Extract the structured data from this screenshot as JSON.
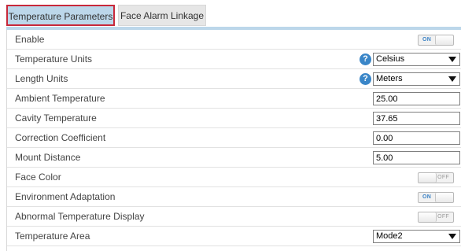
{
  "tabs": {
    "active": "Temperature Parameters",
    "inactive": "Face Alarm Linkage"
  },
  "toggle_text": {
    "on": "ON",
    "off": "OFF"
  },
  "help_glyph": "?",
  "rows": {
    "enable": {
      "label": "Enable",
      "state": "on"
    },
    "temperature_units": {
      "label": "Temperature Units",
      "value": "Celsius"
    },
    "length_units": {
      "label": "Length Units",
      "value": "Meters"
    },
    "ambient_temperature": {
      "label": "Ambient Temperature",
      "value": "25.00"
    },
    "cavity_temperature": {
      "label": "Cavity Temperature",
      "value": "37.65"
    },
    "correction_coefficient": {
      "label": "Correction Coefficient",
      "value": "0.00"
    },
    "mount_distance": {
      "label": "Mount Distance",
      "value": "5.00"
    },
    "face_color": {
      "label": "Face Color",
      "state": "off"
    },
    "environment_adaptation": {
      "label": "Environment Adaptation",
      "state": "on"
    },
    "abnormal_temperature_display": {
      "label": "Abnormal Temperature Display",
      "state": "off"
    },
    "temperature_area": {
      "label": "Temperature Area",
      "value": "Mode2"
    }
  },
  "colors": {
    "tab_active_bg": "#bcd7ea",
    "tab_highlight_border": "#c8283a",
    "help_icon": "#3a86c8",
    "toggle_on_text": "#3d83c5"
  }
}
